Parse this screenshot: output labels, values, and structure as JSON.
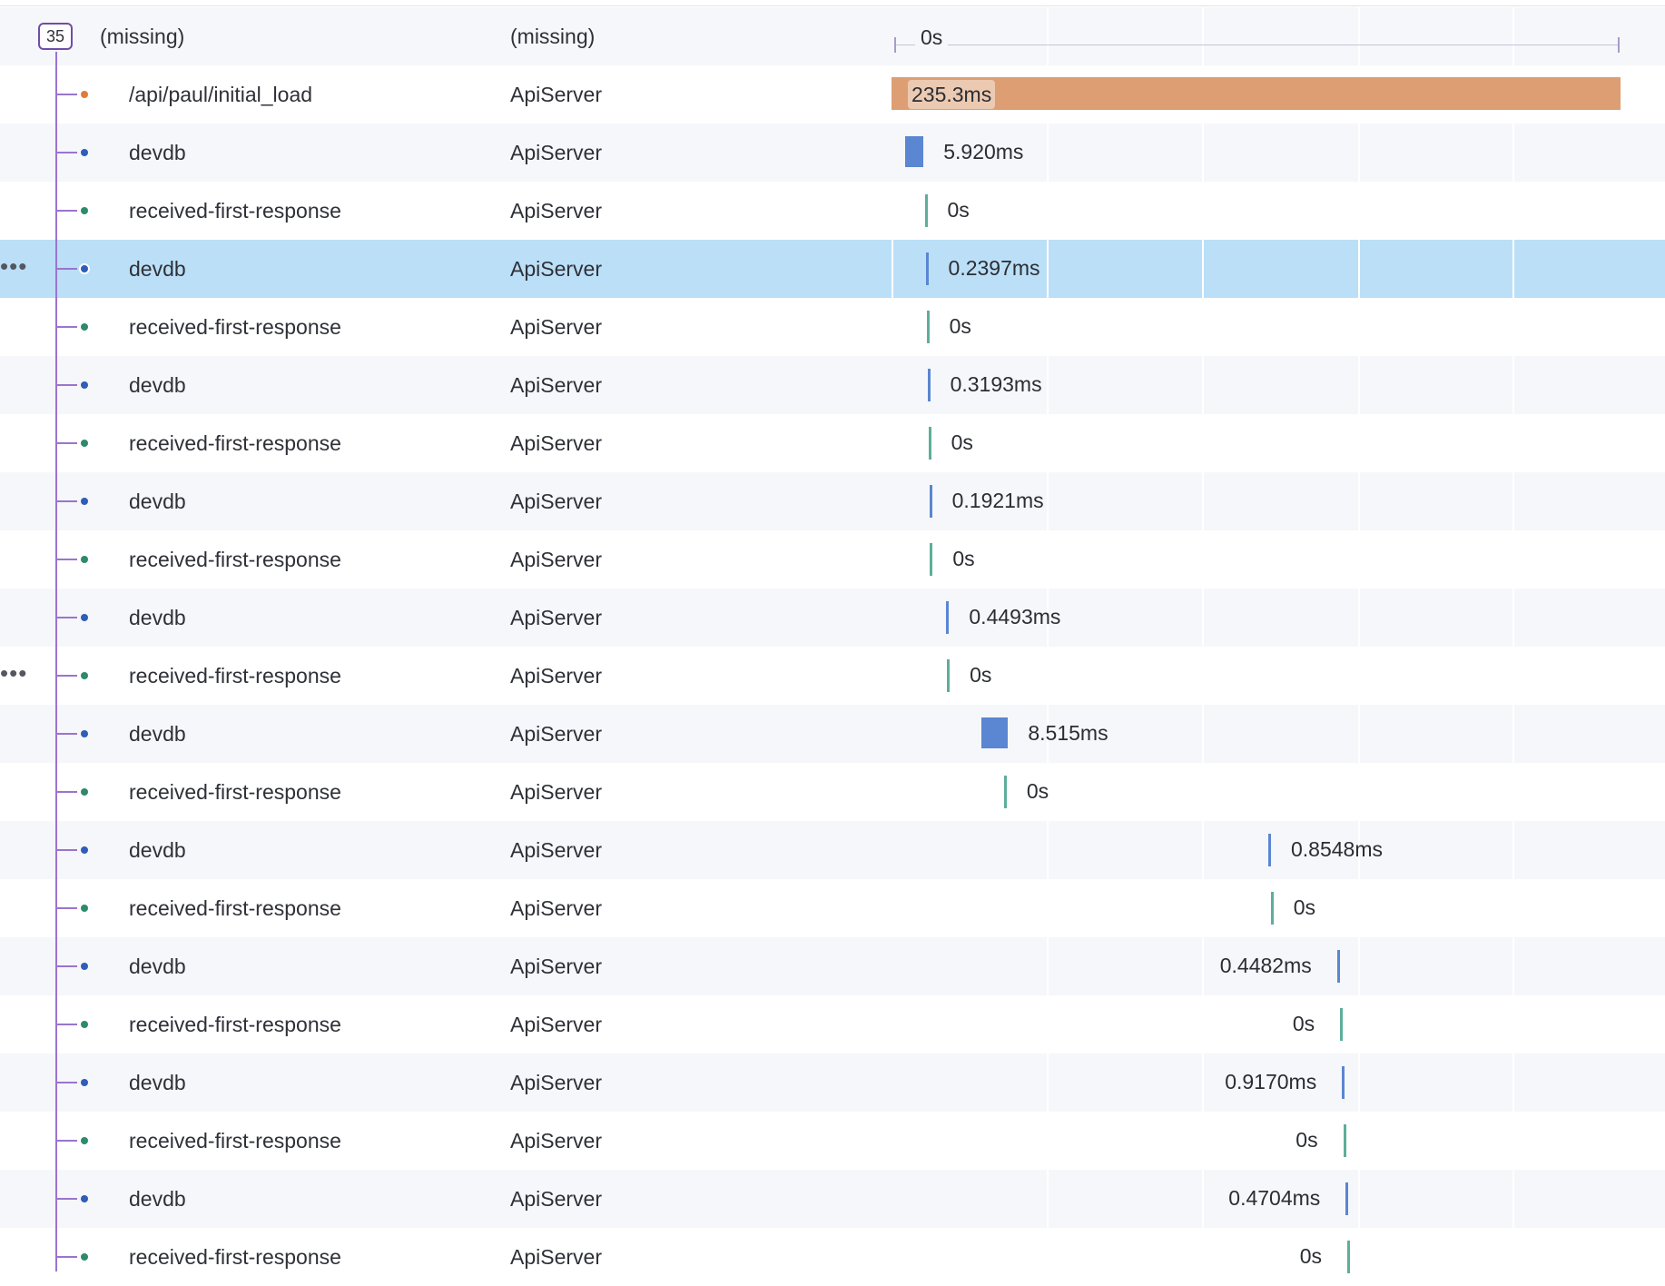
{
  "colors": {
    "root_connector": "#9b74cf",
    "api_span": "#dd9e74",
    "db_span": "#5a86d2",
    "event_marker": "#5eae9a",
    "selected_row": "#bbdff7",
    "api_dot": "#e07b3a",
    "db_dot": "#2f5db7",
    "event_dot": "#2d8a6d"
  },
  "timeline": {
    "total_ms": 235.3
  },
  "root": {
    "count_badge": "35",
    "name": "(missing)",
    "service": "(missing)",
    "duration_label": "0s"
  },
  "spans": [
    {
      "name": "/api/paul/initial_load",
      "service": "ApiServer",
      "kind": "api",
      "start_ms": 0,
      "duration_ms": 235.3,
      "duration_label": "235.3ms",
      "label_side": "inside",
      "selected": false,
      "more": false
    },
    {
      "name": "devdb",
      "service": "ApiServer",
      "kind": "db",
      "start_ms": 4.4,
      "duration_ms": 5.92,
      "duration_label": "5.920ms",
      "label_side": "right",
      "selected": false,
      "more": false
    },
    {
      "name": "received-first-response",
      "service": "ApiServer",
      "kind": "event",
      "start_ms": 10.7,
      "duration_ms": 0,
      "duration_label": "0s",
      "label_side": "right",
      "selected": false,
      "more": false
    },
    {
      "name": "devdb",
      "service": "ApiServer",
      "kind": "db",
      "start_ms": 11.0,
      "duration_ms": 0.2397,
      "duration_label": "0.2397ms",
      "label_side": "right",
      "selected": true,
      "more": true
    },
    {
      "name": "received-first-response",
      "service": "ApiServer",
      "kind": "event",
      "start_ms": 11.3,
      "duration_ms": 0,
      "duration_label": "0s",
      "label_side": "right",
      "selected": false,
      "more": false
    },
    {
      "name": "devdb",
      "service": "ApiServer",
      "kind": "db",
      "start_ms": 11.6,
      "duration_ms": 0.3193,
      "duration_label": "0.3193ms",
      "label_side": "right",
      "selected": false,
      "more": false
    },
    {
      "name": "received-first-response",
      "service": "ApiServer",
      "kind": "event",
      "start_ms": 11.9,
      "duration_ms": 0,
      "duration_label": "0s",
      "label_side": "right",
      "selected": false,
      "more": false
    },
    {
      "name": "devdb",
      "service": "ApiServer",
      "kind": "db",
      "start_ms": 12.2,
      "duration_ms": 0.1921,
      "duration_label": "0.1921ms",
      "label_side": "right",
      "selected": false,
      "more": false
    },
    {
      "name": "received-first-response",
      "service": "ApiServer",
      "kind": "event",
      "start_ms": 12.4,
      "duration_ms": 0,
      "duration_label": "0s",
      "label_side": "right",
      "selected": false,
      "more": false
    },
    {
      "name": "devdb",
      "service": "ApiServer",
      "kind": "db",
      "start_ms": 17.7,
      "duration_ms": 0.4493,
      "duration_label": "0.4493ms",
      "label_side": "right",
      "selected": false,
      "more": false
    },
    {
      "name": "received-first-response",
      "service": "ApiServer",
      "kind": "event",
      "start_ms": 17.9,
      "duration_ms": 0,
      "duration_label": "0s",
      "label_side": "right",
      "selected": false,
      "more": true
    },
    {
      "name": "devdb",
      "service": "ApiServer",
      "kind": "db",
      "start_ms": 29.1,
      "duration_ms": 8.515,
      "duration_label": "8.515ms",
      "label_side": "right",
      "selected": false,
      "more": false
    },
    {
      "name": "received-first-response",
      "service": "ApiServer",
      "kind": "event",
      "start_ms": 36.3,
      "duration_ms": 0,
      "duration_label": "0s",
      "label_side": "right",
      "selected": false,
      "more": false
    },
    {
      "name": "devdb",
      "service": "ApiServer",
      "kind": "db",
      "start_ms": 121.6,
      "duration_ms": 0.8548,
      "duration_label": "0.8548ms",
      "label_side": "right",
      "selected": false,
      "more": false
    },
    {
      "name": "received-first-response",
      "service": "ApiServer",
      "kind": "event",
      "start_ms": 122.4,
      "duration_ms": 0,
      "duration_label": "0s",
      "label_side": "right",
      "selected": false,
      "more": false
    },
    {
      "name": "devdb",
      "service": "ApiServer",
      "kind": "db",
      "start_ms": 143.8,
      "duration_ms": 0.4482,
      "duration_label": "0.4482ms",
      "label_side": "left",
      "selected": false,
      "more": false
    },
    {
      "name": "received-first-response",
      "service": "ApiServer",
      "kind": "event",
      "start_ms": 144.8,
      "duration_ms": 0,
      "duration_label": "0s",
      "label_side": "left",
      "selected": false,
      "more": false
    },
    {
      "name": "devdb",
      "service": "ApiServer",
      "kind": "db",
      "start_ms": 145.4,
      "duration_ms": 0.917,
      "duration_label": "0.9170ms",
      "label_side": "left",
      "selected": false,
      "more": false
    },
    {
      "name": "received-first-response",
      "service": "ApiServer",
      "kind": "event",
      "start_ms": 145.8,
      "duration_ms": 0,
      "duration_label": "0s",
      "label_side": "left",
      "selected": false,
      "more": false
    },
    {
      "name": "devdb",
      "service": "ApiServer",
      "kind": "db",
      "start_ms": 146.6,
      "duration_ms": 0.4704,
      "duration_label": "0.4704ms",
      "label_side": "left",
      "selected": false,
      "more": false
    },
    {
      "name": "received-first-response",
      "service": "ApiServer",
      "kind": "event",
      "start_ms": 147.1,
      "duration_ms": 0,
      "duration_label": "0s",
      "label_side": "left",
      "selected": false,
      "more": false
    }
  ]
}
